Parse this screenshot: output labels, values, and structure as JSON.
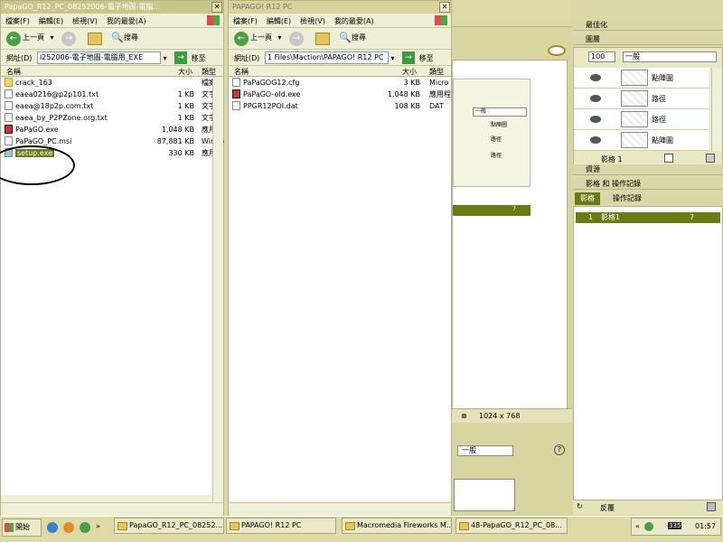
{
  "left_window": {
    "title": "PapaGO_R12_PC_08252006-電子地圖-電腦...",
    "menu": [
      "檔案(F)",
      "編輯(E)",
      "檢視(V)",
      "我的最愛(A)"
    ],
    "toolbar": {
      "back": "上一頁",
      "search": "搜尋"
    },
    "address": {
      "label": "網址(D)",
      "value": "l252006-電子地圖-電腦用_EXE",
      "go": "移至"
    },
    "columns": {
      "name": "名稱",
      "size": "大小",
      "type": "類型"
    },
    "files": [
      {
        "name": "crack_163",
        "size": "",
        "type": "檔案資",
        "icon": "folder-icon"
      },
      {
        "name": "eaea0216@p2p101.txt",
        "size": "1 KB",
        "type": "文字文",
        "icon": "text-file-icon"
      },
      {
        "name": "eaea@18p2p.com.txt",
        "size": "1 KB",
        "type": "文字文",
        "icon": "text-file-icon"
      },
      {
        "name": "eaea_by_P2PZone.org.txt",
        "size": "1 KB",
        "type": "文字文",
        "icon": "text-file-icon"
      },
      {
        "name": "PaPaGO.exe",
        "size": "1,048 KB",
        "type": "應用程",
        "icon": "exe-icon"
      },
      {
        "name": "PaPaGO_PC.msi",
        "size": "87,881 KB",
        "type": "Windo",
        "icon": "msi-icon"
      },
      {
        "name": "setup.exe",
        "size": "330 KB",
        "type": "應用程",
        "icon": "setup-icon"
      }
    ]
  },
  "right_window": {
    "title": "PAPAGO! R12 PC",
    "menu": [
      "檔案(F)",
      "編輯(E)",
      "檢視(V)",
      "我的最愛(A)"
    ],
    "toolbar": {
      "back": "上一頁",
      "search": "搜尋"
    },
    "address": {
      "label": "網址(D)",
      "value": "1 Files\\Maction\\PAPAGO! R12 PC",
      "go": "移至"
    },
    "columns": {
      "name": "名稱",
      "size": "大小",
      "type": "類型"
    },
    "files": [
      {
        "name": "PaPaGOG12.cfg",
        "size": "3 KB",
        "type": "Micro",
        "icon": "cfg-icon"
      },
      {
        "name": "PaPaGO-old.exe",
        "size": "1,048 KB",
        "type": "應用程",
        "icon": "exe-icon"
      },
      {
        "name": "PPGR12POI.dat",
        "size": "108 KB",
        "type": "DAT",
        "icon": "dat-icon"
      }
    ]
  },
  "fireworks": {
    "optimize_header": "最佳化",
    "layers_header": "圖層",
    "opacity": "100",
    "blend_mode": "一般",
    "layers": [
      "點陣圖",
      "路徑",
      "路徑",
      "點陣圖"
    ],
    "frame_label": "影格 1",
    "assets_header": "資源",
    "frames_history_header": "影格 和 操作記錄",
    "tabs": [
      "影格",
      "操作記錄"
    ],
    "frame_row": {
      "index": "1",
      "name": "影格1",
      "delay": "7"
    },
    "loop_label": "反覆",
    "canvas_size": "1024 x 768",
    "blend2": "一般",
    "small_layers": [
      "點陣圖",
      "路徑",
      "路徑"
    ]
  },
  "taskbar": {
    "start": "開始",
    "tasks": [
      "PapaGO_R12_PC_08252...",
      "PAPAGO! R12 PC",
      "Macromedia Fireworks M...",
      "48-PapaGO_R12_PC_08..."
    ],
    "tray_badge": "335",
    "clock": "01:57"
  }
}
